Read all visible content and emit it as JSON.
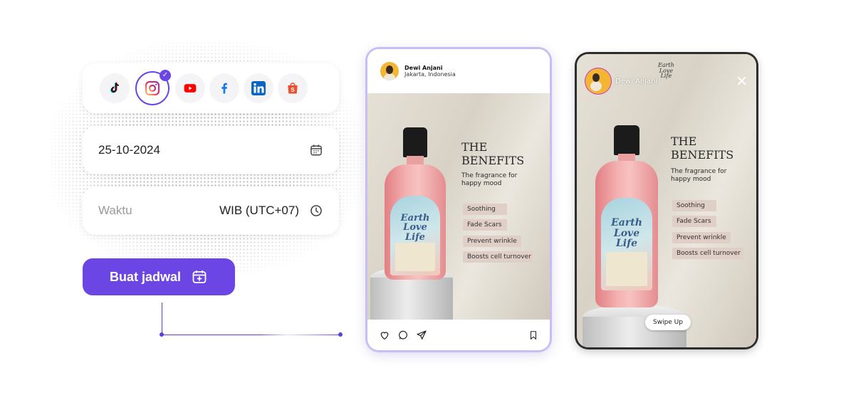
{
  "scheduler": {
    "platforms": [
      {
        "name": "TikTok",
        "icon": "tiktok-icon",
        "selected": false
      },
      {
        "name": "Instagram",
        "icon": "instagram-icon",
        "selected": true
      },
      {
        "name": "YouTube",
        "icon": "youtube-icon",
        "selected": false
      },
      {
        "name": "Facebook",
        "icon": "facebook-icon",
        "selected": false
      },
      {
        "name": "LinkedIn",
        "icon": "linkedin-icon",
        "selected": false
      },
      {
        "name": "Shopee",
        "icon": "shopee-icon",
        "selected": false
      }
    ],
    "date_value": "25-10-2024",
    "time_placeholder": "Waktu",
    "timezone": "WIB (UTC+07)",
    "create_button": "Buat jadwal",
    "accent_color": "#6b46e5"
  },
  "feed_post": {
    "user_name": "Dewi Anjani",
    "location": "Jakarta, Indonesia",
    "title_line1": "THE",
    "title_line2": "BENEFITS",
    "subtitle_line1": "The fragrance for",
    "subtitle_line2": "happy mood",
    "benefits": [
      "Soothing",
      "Fade Scars",
      "Prevent wrinkle",
      "Boosts cell turnover"
    ],
    "label_line1": "Earth",
    "label_line2": "Love",
    "label_line3": "Life"
  },
  "story_post": {
    "user_name": "Dewi Anjani",
    "logo_line1": "Earth",
    "logo_line2": "Love",
    "logo_line3": "Life",
    "close_symbol": "✕",
    "title_line1": "THE",
    "title_line2": "BENEFITS",
    "subtitle_line1": "The fragrance for",
    "subtitle_line2": "happy mood",
    "benefits": [
      "Soothing",
      "Fade Scars",
      "Prevent wrinkle",
      "Boosts cell turnover"
    ],
    "label_line1": "Earth",
    "label_line2": "Love",
    "label_line3": "Life",
    "swipe_label": "Swipe Up"
  }
}
